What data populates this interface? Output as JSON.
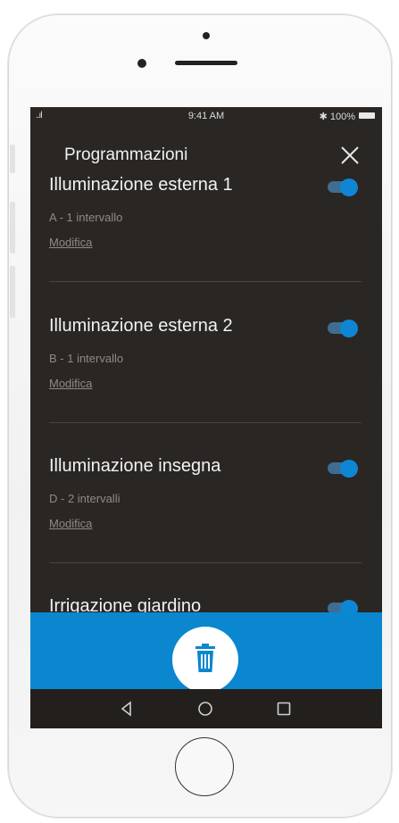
{
  "status_bar": {
    "signal": "..ıl",
    "time": "9:41 AM",
    "battery_text": "✱ 100%"
  },
  "header": {
    "title": "Programmazioni",
    "close_icon": "close-icon"
  },
  "schedules": [
    {
      "name": "Illuminazione esterna 1",
      "subtitle": "A - 1 intervallo",
      "edit_label": "Modifica",
      "enabled": true
    },
    {
      "name": "Illuminazione esterna 2",
      "subtitle": "B - 1 intervallo",
      "edit_label": "Modifica",
      "enabled": true
    },
    {
      "name": "Illuminazione insegna",
      "subtitle": "D - 2 intervalli",
      "edit_label": "Modifica",
      "enabled": true
    },
    {
      "name": "Irrigazione giardino",
      "subtitle": "",
      "edit_label": "",
      "enabled": true
    }
  ],
  "action_bar": {
    "delete_icon": "trash-icon",
    "color": "#0a87cf"
  },
  "nav": {
    "back_icon": "back-triangle-icon",
    "home_icon": "home-circle-icon",
    "recents_icon": "recents-square-icon"
  },
  "colors": {
    "screen_bg": "#2a2623",
    "accent": "#0f86d4"
  }
}
